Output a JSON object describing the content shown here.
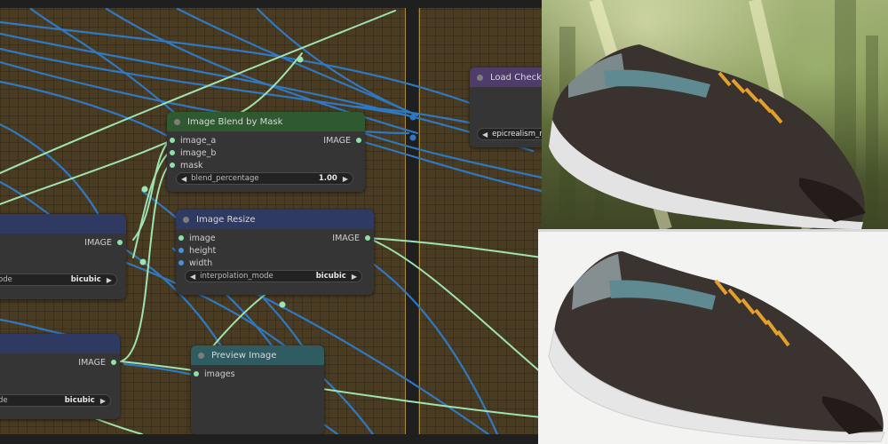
{
  "nodes": {
    "image_blend_by_mask": {
      "title": "Image Blend by Mask",
      "inputs": [
        "image_a",
        "image_b",
        "mask"
      ],
      "output": "IMAGE",
      "widget": {
        "label": "blend_percentage",
        "value": "1.00"
      }
    },
    "image_resize": {
      "title": "Image Resize",
      "inputs": [
        "image",
        "height",
        "width"
      ],
      "output": "IMAGE",
      "widget": {
        "label": "interpolation_mode",
        "value": "bicubic"
      }
    },
    "preview_image": {
      "title": "Preview Image",
      "inputs": [
        "images"
      ]
    },
    "load_checkpoint": {
      "title": "Load Checkpoi",
      "widget_value": "epicrealism_natu"
    },
    "left_node_1": {
      "output": "IMAGE",
      "widget": {
        "label": "ode",
        "value": "bicubic"
      }
    },
    "left_node_2": {
      "output": "IMAGE",
      "widget": {
        "label": "de",
        "value": "bicubic"
      }
    }
  },
  "colors": {
    "canvas": "#4a3c22",
    "node_body": "#353535",
    "blend_header": "#2f5a2f",
    "resize_header": "#2f3a63",
    "preview_header": "#2f5c60",
    "checkpoint_header": "#4e3c6a",
    "image_wire": "#9fe3b0",
    "int_wire": "#2f78c2"
  },
  "images": {
    "top_photo": "running shoe on forest background",
    "bottom_photo": "running shoe on white background"
  }
}
